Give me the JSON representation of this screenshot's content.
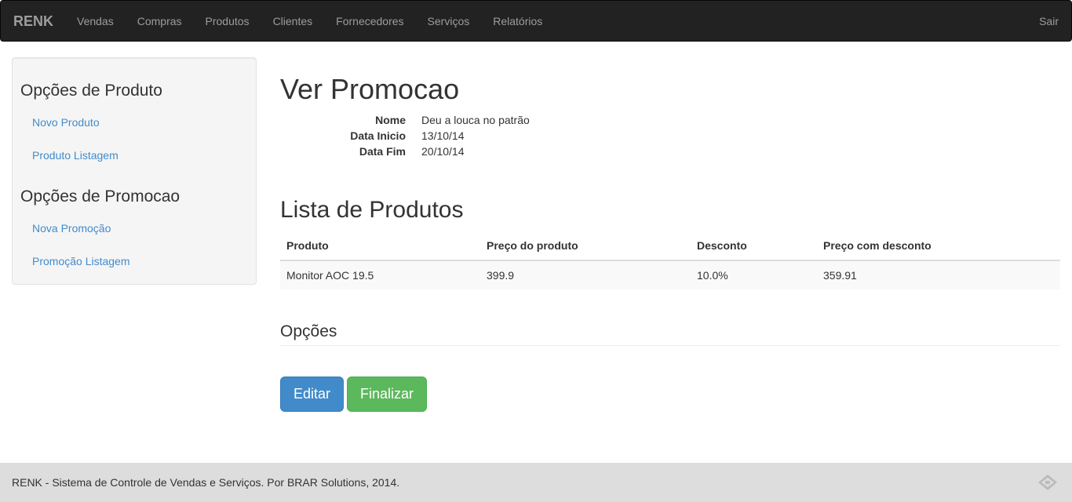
{
  "navbar": {
    "brand": "RENK",
    "items": [
      "Vendas",
      "Compras",
      "Produtos",
      "Clientes",
      "Fornecedores",
      "Serviços",
      "Relatórios"
    ],
    "logout": "Sair"
  },
  "sidebar": {
    "produto_heading": "Opções de Produto",
    "novo_produto": "Novo Produto",
    "produto_listagem": "Produto Listagem",
    "promocao_heading": "Opções de Promocao",
    "nova_promocao": "Nova Promoção",
    "promocao_listagem": "Promoção Listagem"
  },
  "main": {
    "title": "Ver Promocao",
    "details": {
      "nome_label": "Nome",
      "nome_value": "Deu a louca no patrão",
      "inicio_label": "Data Inicio",
      "inicio_value": "13/10/14",
      "fim_label": "Data Fim",
      "fim_value": "20/10/14"
    },
    "list_title": "Lista de Produtos",
    "table": {
      "headers": [
        "Produto",
        "Preço do produto",
        "Desconto",
        "Preço com desconto"
      ],
      "rows": [
        [
          "Monitor AOC 19.5",
          "399.9",
          "10.0%",
          "359.91"
        ]
      ]
    },
    "options_title": "Opções",
    "edit_button": "Editar",
    "finish_button": "Finalizar"
  },
  "footer": {
    "text": "RENK - Sistema de Controle de Vendas e Serviços. Por BRAR Solutions, 2014."
  }
}
